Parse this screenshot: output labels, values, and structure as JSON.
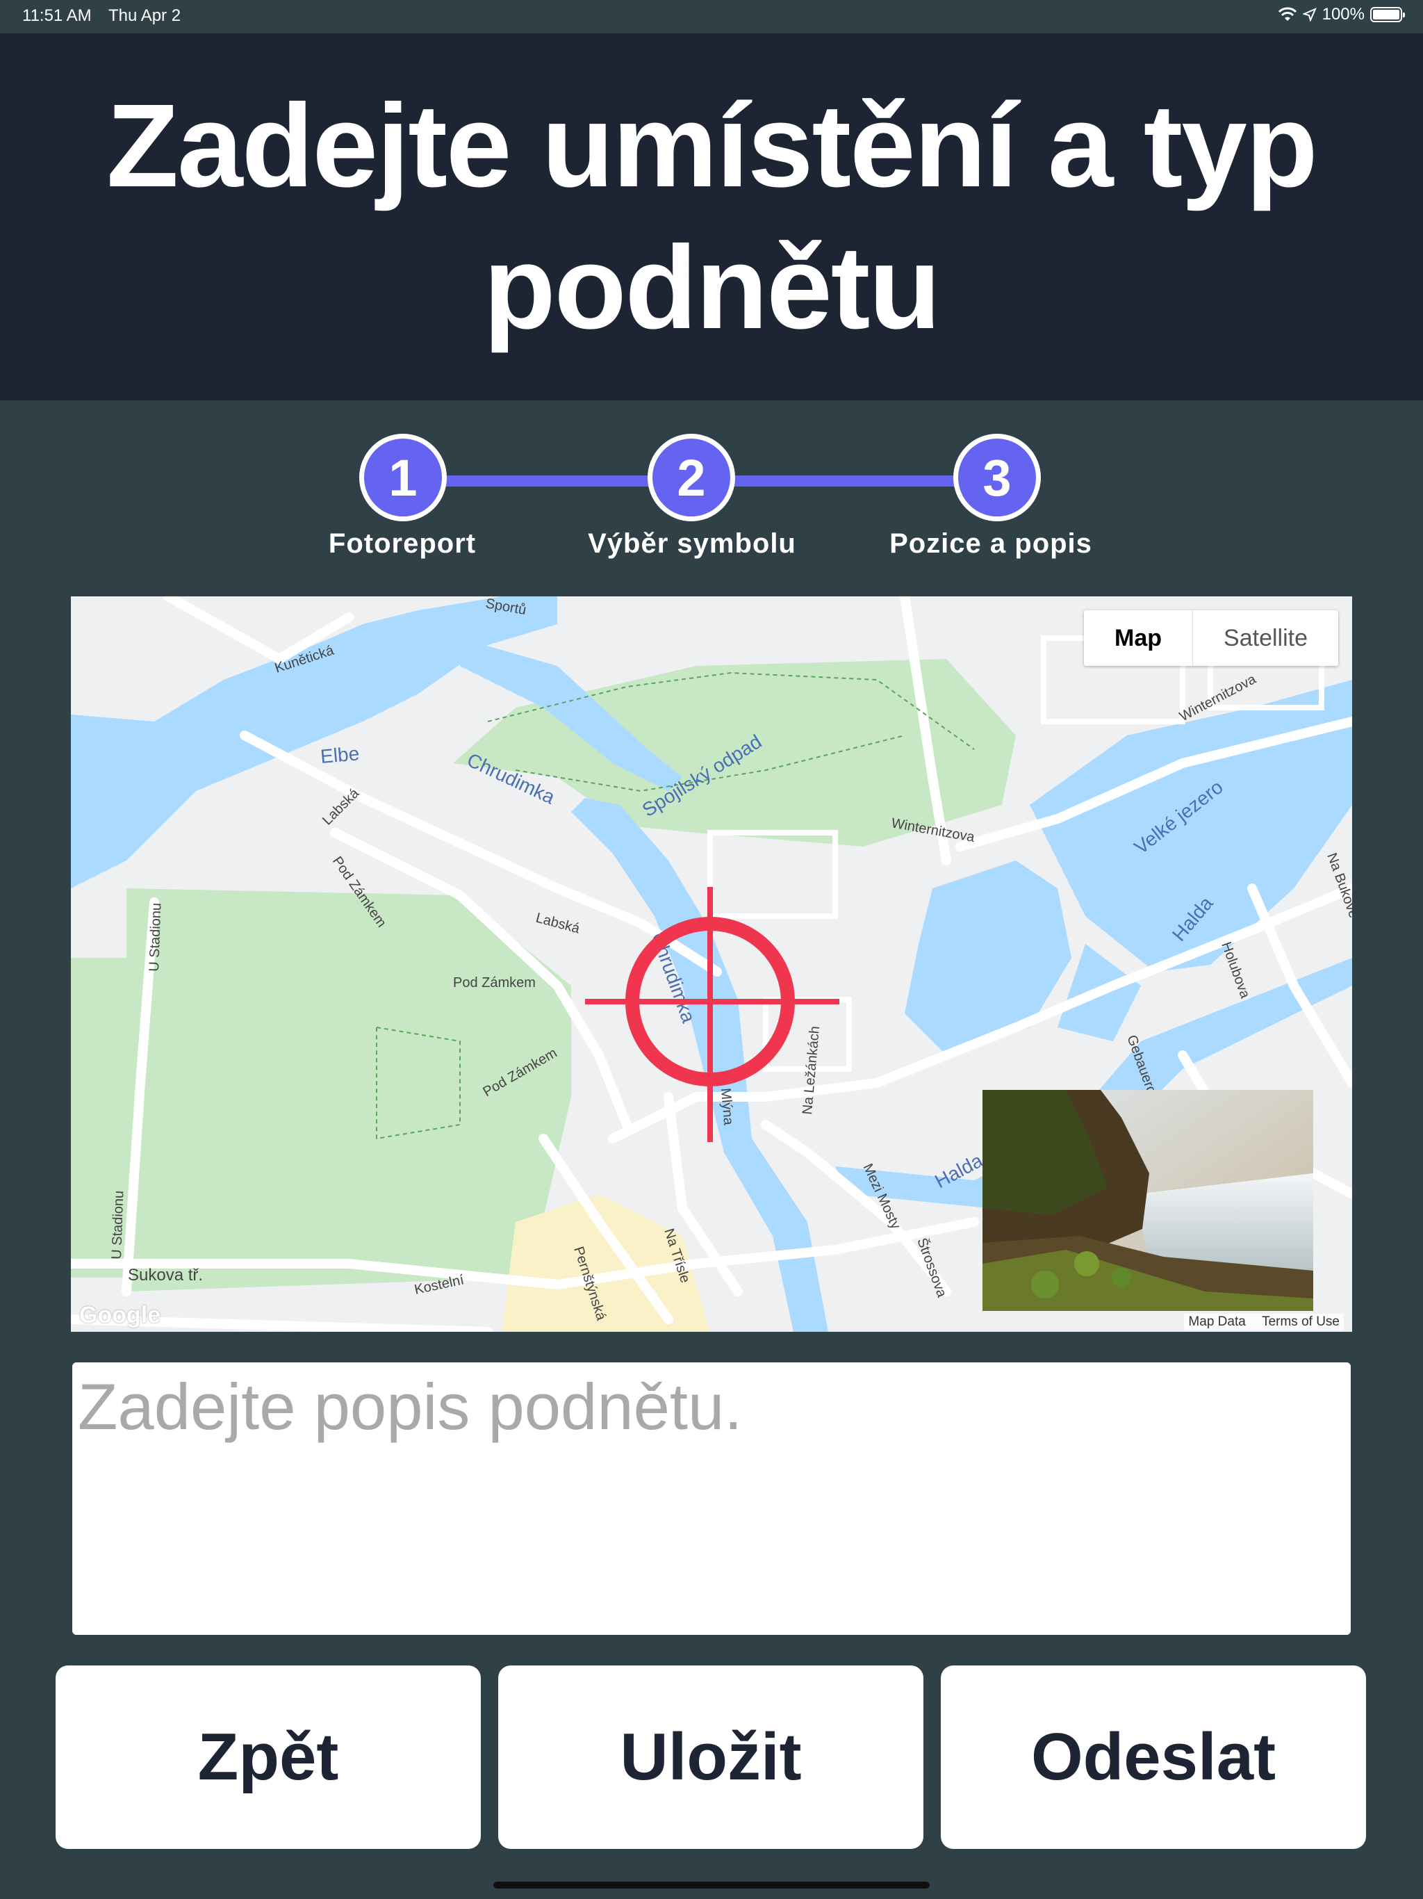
{
  "status_bar": {
    "time": "11:51 AM",
    "date": "Thu Apr 2",
    "battery": "100%",
    "battery_level": 1.0
  },
  "header": {
    "title": "Zadejte umístění a typ podnětu"
  },
  "stepper": {
    "steps": [
      {
        "number": "1",
        "label": "Fotoreport"
      },
      {
        "number": "2",
        "label": "Výběr symbolu"
      },
      {
        "number": "3",
        "label": "Pozice a popis"
      }
    ],
    "accent_color": "#6464f0"
  },
  "map": {
    "type_toggle": {
      "map_label": "Map",
      "satellite_label": "Satellite",
      "selected": "Map"
    },
    "logo": "Google",
    "attribution": {
      "data": "Map Data",
      "terms": "Terms of Use"
    },
    "labels": {
      "elbe": "Elbe",
      "chrudimka_1": "Chrudimka",
      "chrudimka_2": "Chrudimka",
      "spojilsky": "Spojilský odpad",
      "velke_jezero": "Velké jezero",
      "halda_1": "Halda",
      "halda_2": "Halda",
      "kuneticka": "Kunětická",
      "labska_1": "Labská",
      "labska_2": "Labská",
      "pod_zamkem_1": "Pod Zámkem",
      "pod_zamkem_2": "Pod Zámkem",
      "pod_zamkem_3": "Pod Zámkem",
      "u_stadionu_1": "U Stadionu",
      "u_stadionu_2": "U Stadionu",
      "sukova": "Sukova tř.",
      "kostelni": "Kostelní",
      "pernstynska": "Pernštýnská",
      "na_trisle": "Na Třísle",
      "na_lezankach": "Na Ležánkách",
      "mezi_mosty": "Mezi Mosty",
      "strossova": "Štrossova",
      "winternitzova_1": "Winternitzova",
      "winternitzova_2": "Winternitzova",
      "holubova": "Holubova",
      "gebauerova": "Gebauerova",
      "na_bukove": "Na Bukové",
      "u_mlyna": "U Mlýna",
      "sportu": "Sportů"
    },
    "crosshair_color": "#f0364f"
  },
  "description": {
    "placeholder": "Zadejte popis podnětu.",
    "value": ""
  },
  "buttons": {
    "back": "Zpět",
    "save": "Uložit",
    "send": "Odeslat"
  }
}
